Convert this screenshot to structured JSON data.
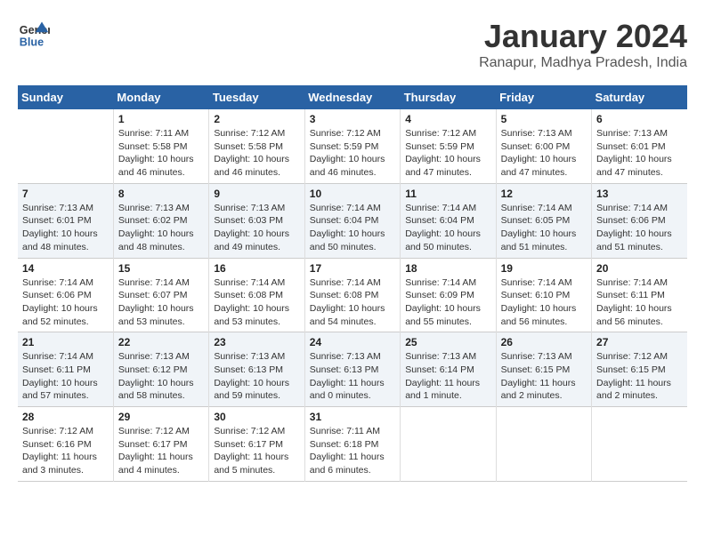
{
  "header": {
    "logo_line1": "General",
    "logo_line2": "Blue",
    "month_title": "January 2024",
    "location": "Ranapur, Madhya Pradesh, India"
  },
  "calendar": {
    "days_of_week": [
      "Sunday",
      "Monday",
      "Tuesday",
      "Wednesday",
      "Thursday",
      "Friday",
      "Saturday"
    ],
    "weeks": [
      [
        {
          "day": "",
          "info": ""
        },
        {
          "day": "1",
          "info": "Sunrise: 7:11 AM\nSunset: 5:58 PM\nDaylight: 10 hours\nand 46 minutes."
        },
        {
          "day": "2",
          "info": "Sunrise: 7:12 AM\nSunset: 5:58 PM\nDaylight: 10 hours\nand 46 minutes."
        },
        {
          "day": "3",
          "info": "Sunrise: 7:12 AM\nSunset: 5:59 PM\nDaylight: 10 hours\nand 46 minutes."
        },
        {
          "day": "4",
          "info": "Sunrise: 7:12 AM\nSunset: 5:59 PM\nDaylight: 10 hours\nand 47 minutes."
        },
        {
          "day": "5",
          "info": "Sunrise: 7:13 AM\nSunset: 6:00 PM\nDaylight: 10 hours\nand 47 minutes."
        },
        {
          "day": "6",
          "info": "Sunrise: 7:13 AM\nSunset: 6:01 PM\nDaylight: 10 hours\nand 47 minutes."
        }
      ],
      [
        {
          "day": "7",
          "info": "Sunrise: 7:13 AM\nSunset: 6:01 PM\nDaylight: 10 hours\nand 48 minutes."
        },
        {
          "day": "8",
          "info": "Sunrise: 7:13 AM\nSunset: 6:02 PM\nDaylight: 10 hours\nand 48 minutes."
        },
        {
          "day": "9",
          "info": "Sunrise: 7:13 AM\nSunset: 6:03 PM\nDaylight: 10 hours\nand 49 minutes."
        },
        {
          "day": "10",
          "info": "Sunrise: 7:14 AM\nSunset: 6:04 PM\nDaylight: 10 hours\nand 50 minutes."
        },
        {
          "day": "11",
          "info": "Sunrise: 7:14 AM\nSunset: 6:04 PM\nDaylight: 10 hours\nand 50 minutes."
        },
        {
          "day": "12",
          "info": "Sunrise: 7:14 AM\nSunset: 6:05 PM\nDaylight: 10 hours\nand 51 minutes."
        },
        {
          "day": "13",
          "info": "Sunrise: 7:14 AM\nSunset: 6:06 PM\nDaylight: 10 hours\nand 51 minutes."
        }
      ],
      [
        {
          "day": "14",
          "info": "Sunrise: 7:14 AM\nSunset: 6:06 PM\nDaylight: 10 hours\nand 52 minutes."
        },
        {
          "day": "15",
          "info": "Sunrise: 7:14 AM\nSunset: 6:07 PM\nDaylight: 10 hours\nand 53 minutes."
        },
        {
          "day": "16",
          "info": "Sunrise: 7:14 AM\nSunset: 6:08 PM\nDaylight: 10 hours\nand 53 minutes."
        },
        {
          "day": "17",
          "info": "Sunrise: 7:14 AM\nSunset: 6:08 PM\nDaylight: 10 hours\nand 54 minutes."
        },
        {
          "day": "18",
          "info": "Sunrise: 7:14 AM\nSunset: 6:09 PM\nDaylight: 10 hours\nand 55 minutes."
        },
        {
          "day": "19",
          "info": "Sunrise: 7:14 AM\nSunset: 6:10 PM\nDaylight: 10 hours\nand 56 minutes."
        },
        {
          "day": "20",
          "info": "Sunrise: 7:14 AM\nSunset: 6:11 PM\nDaylight: 10 hours\nand 56 minutes."
        }
      ],
      [
        {
          "day": "21",
          "info": "Sunrise: 7:14 AM\nSunset: 6:11 PM\nDaylight: 10 hours\nand 57 minutes."
        },
        {
          "day": "22",
          "info": "Sunrise: 7:13 AM\nSunset: 6:12 PM\nDaylight: 10 hours\nand 58 minutes."
        },
        {
          "day": "23",
          "info": "Sunrise: 7:13 AM\nSunset: 6:13 PM\nDaylight: 10 hours\nand 59 minutes."
        },
        {
          "day": "24",
          "info": "Sunrise: 7:13 AM\nSunset: 6:13 PM\nDaylight: 11 hours\nand 0 minutes."
        },
        {
          "day": "25",
          "info": "Sunrise: 7:13 AM\nSunset: 6:14 PM\nDaylight: 11 hours\nand 1 minute."
        },
        {
          "day": "26",
          "info": "Sunrise: 7:13 AM\nSunset: 6:15 PM\nDaylight: 11 hours\nand 2 minutes."
        },
        {
          "day": "27",
          "info": "Sunrise: 7:12 AM\nSunset: 6:15 PM\nDaylight: 11 hours\nand 2 minutes."
        }
      ],
      [
        {
          "day": "28",
          "info": "Sunrise: 7:12 AM\nSunset: 6:16 PM\nDaylight: 11 hours\nand 3 minutes."
        },
        {
          "day": "29",
          "info": "Sunrise: 7:12 AM\nSunset: 6:17 PM\nDaylight: 11 hours\nand 4 minutes."
        },
        {
          "day": "30",
          "info": "Sunrise: 7:12 AM\nSunset: 6:17 PM\nDaylight: 11 hours\nand 5 minutes."
        },
        {
          "day": "31",
          "info": "Sunrise: 7:11 AM\nSunset: 6:18 PM\nDaylight: 11 hours\nand 6 minutes."
        },
        {
          "day": "",
          "info": ""
        },
        {
          "day": "",
          "info": ""
        },
        {
          "day": "",
          "info": ""
        }
      ]
    ]
  }
}
